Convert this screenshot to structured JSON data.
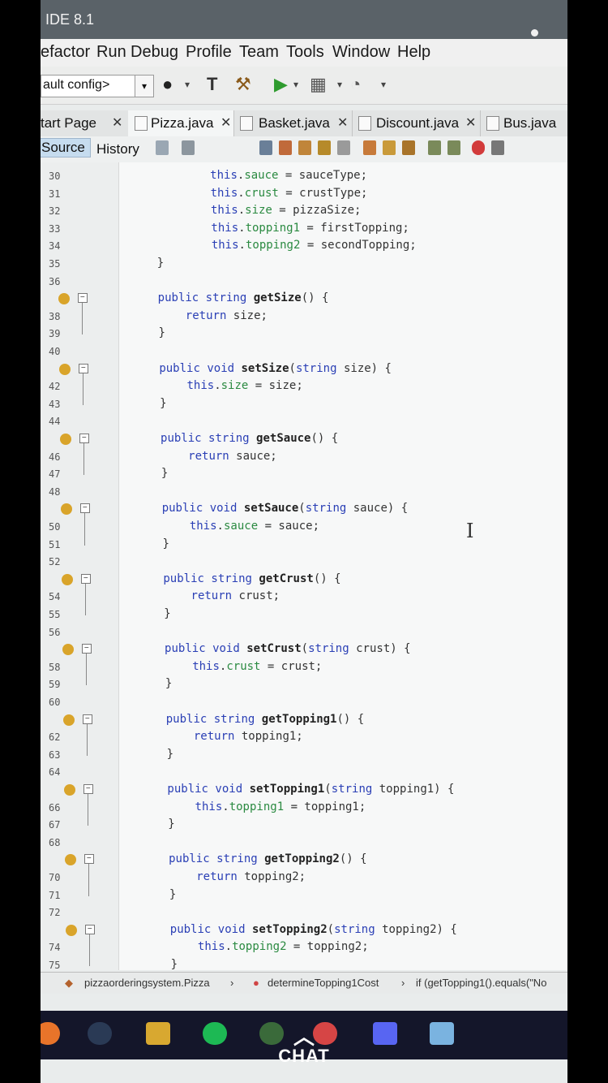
{
  "window": {
    "title": "IDE 8.1"
  },
  "menu": [
    "efactor",
    "Run",
    "Debug",
    "Profile",
    "Team",
    "Tools",
    "Window",
    "Help"
  ],
  "toolbar": {
    "config_value": "ault config>"
  },
  "tabs": [
    {
      "label": "tart Page"
    },
    {
      "label": "Pizza.java"
    },
    {
      "label": "Basket.java"
    },
    {
      "label": "Discount.java"
    },
    {
      "label": "Bus.java"
    }
  ],
  "view": {
    "source": "Source",
    "history": "History"
  },
  "code": {
    "lines": [
      {
        "n": "30",
        "t": "            this.sauce = sauceType;"
      },
      {
        "n": "31",
        "t": "            this.crust = crustType;"
      },
      {
        "n": "32",
        "t": "            this.size = pizzaSize;"
      },
      {
        "n": "33",
        "t": "            this.topping1 = firstTopping;"
      },
      {
        "n": "34",
        "t": "            this.topping2 = secondTopping;"
      },
      {
        "n": "35",
        "t": "    }"
      },
      {
        "n": "36",
        "t": ""
      },
      {
        "n": "",
        "t": "    public string getSize() {"
      },
      {
        "n": "38",
        "t": "        return size;"
      },
      {
        "n": "39",
        "t": "    }"
      },
      {
        "n": "40",
        "t": ""
      },
      {
        "n": "",
        "t": "    public void setSize(string size) {"
      },
      {
        "n": "42",
        "t": "        this.size = size;"
      },
      {
        "n": "43",
        "t": "    }"
      },
      {
        "n": "44",
        "t": ""
      },
      {
        "n": "",
        "t": "    public string getSauce() {"
      },
      {
        "n": "46",
        "t": "        return sauce;"
      },
      {
        "n": "47",
        "t": "    }"
      },
      {
        "n": "48",
        "t": ""
      },
      {
        "n": "",
        "t": "    public void setSauce(string sauce) {"
      },
      {
        "n": "50",
        "t": "        this.sauce = sauce;"
      },
      {
        "n": "51",
        "t": "    }"
      },
      {
        "n": "52",
        "t": ""
      },
      {
        "n": "",
        "t": "    public string getCrust() {"
      },
      {
        "n": "54",
        "t": "        return crust;"
      },
      {
        "n": "55",
        "t": "    }"
      },
      {
        "n": "56",
        "t": ""
      },
      {
        "n": "",
        "t": "    public void setCrust(string crust) {"
      },
      {
        "n": "58",
        "t": "        this.crust = crust;"
      },
      {
        "n": "59",
        "t": "    }"
      },
      {
        "n": "60",
        "t": ""
      },
      {
        "n": "",
        "t": "    public string getTopping1() {"
      },
      {
        "n": "62",
        "t": "        return topping1;"
      },
      {
        "n": "63",
        "t": "    }"
      },
      {
        "n": "64",
        "t": ""
      },
      {
        "n": "",
        "t": "    public void setTopping1(string topping1) {"
      },
      {
        "n": "66",
        "t": "        this.topping1 = topping1;"
      },
      {
        "n": "67",
        "t": "    }"
      },
      {
        "n": "68",
        "t": ""
      },
      {
        "n": "",
        "t": "    public string getTopping2() {"
      },
      {
        "n": "70",
        "t": "        return topping2;"
      },
      {
        "n": "71",
        "t": "    }"
      },
      {
        "n": "72",
        "t": ""
      },
      {
        "n": "",
        "t": "    public void setTopping2(string topping2) {"
      },
      {
        "n": "74",
        "t": "        this.topping2 = topping2;"
      },
      {
        "n": "75",
        "t": "    }"
      }
    ]
  },
  "status": {
    "breadcrumb1": "pizzaorderingsystem.Pizza",
    "breadcrumb2": "determineTopping1Cost",
    "breadcrumb3": "if (getTopping1().equals(\"No"
  },
  "overlay": {
    "chat_label": "CHAT"
  }
}
